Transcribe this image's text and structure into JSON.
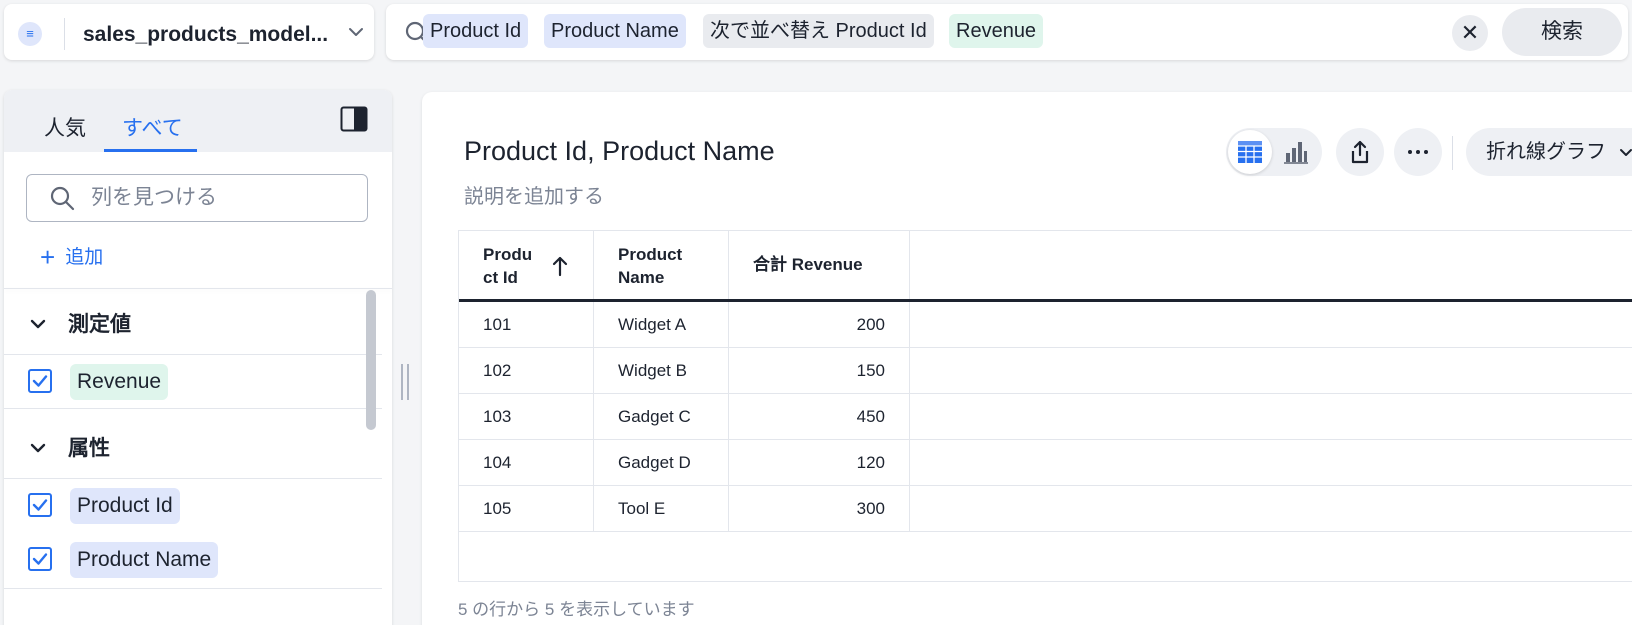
{
  "top_bar": {
    "model_name": "sales_products_model...",
    "search_tokens": [
      {
        "label": "Product Id",
        "kind": "attribute"
      },
      {
        "label": "Product Name",
        "kind": "attribute"
      },
      {
        "label": "次で並べ替え Product Id",
        "kind": "sort"
      },
      {
        "label": "Revenue",
        "kind": "measure"
      }
    ],
    "clear_symbol": "✕",
    "search_button": "検索"
  },
  "left_panel": {
    "tabs": [
      {
        "label": "人気",
        "active": false
      },
      {
        "label": "すべて",
        "active": true
      }
    ],
    "find_placeholder": "列を見つける",
    "add_label": "追加",
    "sections": [
      {
        "title": "測定値",
        "items": [
          {
            "label": "Revenue",
            "checked": true,
            "kind": "measure"
          }
        ]
      },
      {
        "title": "属性",
        "items": [
          {
            "label": "Product Id",
            "checked": true,
            "kind": "attribute"
          },
          {
            "label": "Product Name",
            "checked": true,
            "kind": "attribute"
          }
        ]
      }
    ]
  },
  "main": {
    "title": "Product Id, Product Name",
    "description_placeholder": "説明を追加する",
    "chart_type": "折れ線グラフ",
    "table": {
      "columns": [
        {
          "line1": "Produ",
          "line2": "ct Id",
          "sorted": "asc"
        },
        {
          "line1": "Product",
          "line2": "Name"
        },
        {
          "line1": "合計 Revenue",
          "line2": ""
        }
      ],
      "rows": [
        [
          "101",
          "Widget A",
          "200"
        ],
        [
          "102",
          "Widget B",
          "150"
        ],
        [
          "103",
          "Gadget C",
          "450"
        ],
        [
          "104",
          "Gadget D",
          "120"
        ],
        [
          "105",
          "Tool E",
          "300"
        ]
      ]
    },
    "footer": "5 の行から 5 を表示しています"
  },
  "colors": {
    "accent": "#2770ef",
    "attribute_chip": "#dfe6fb",
    "measure_chip": "#dff5ec",
    "sort_chip": "#e9ebef"
  }
}
